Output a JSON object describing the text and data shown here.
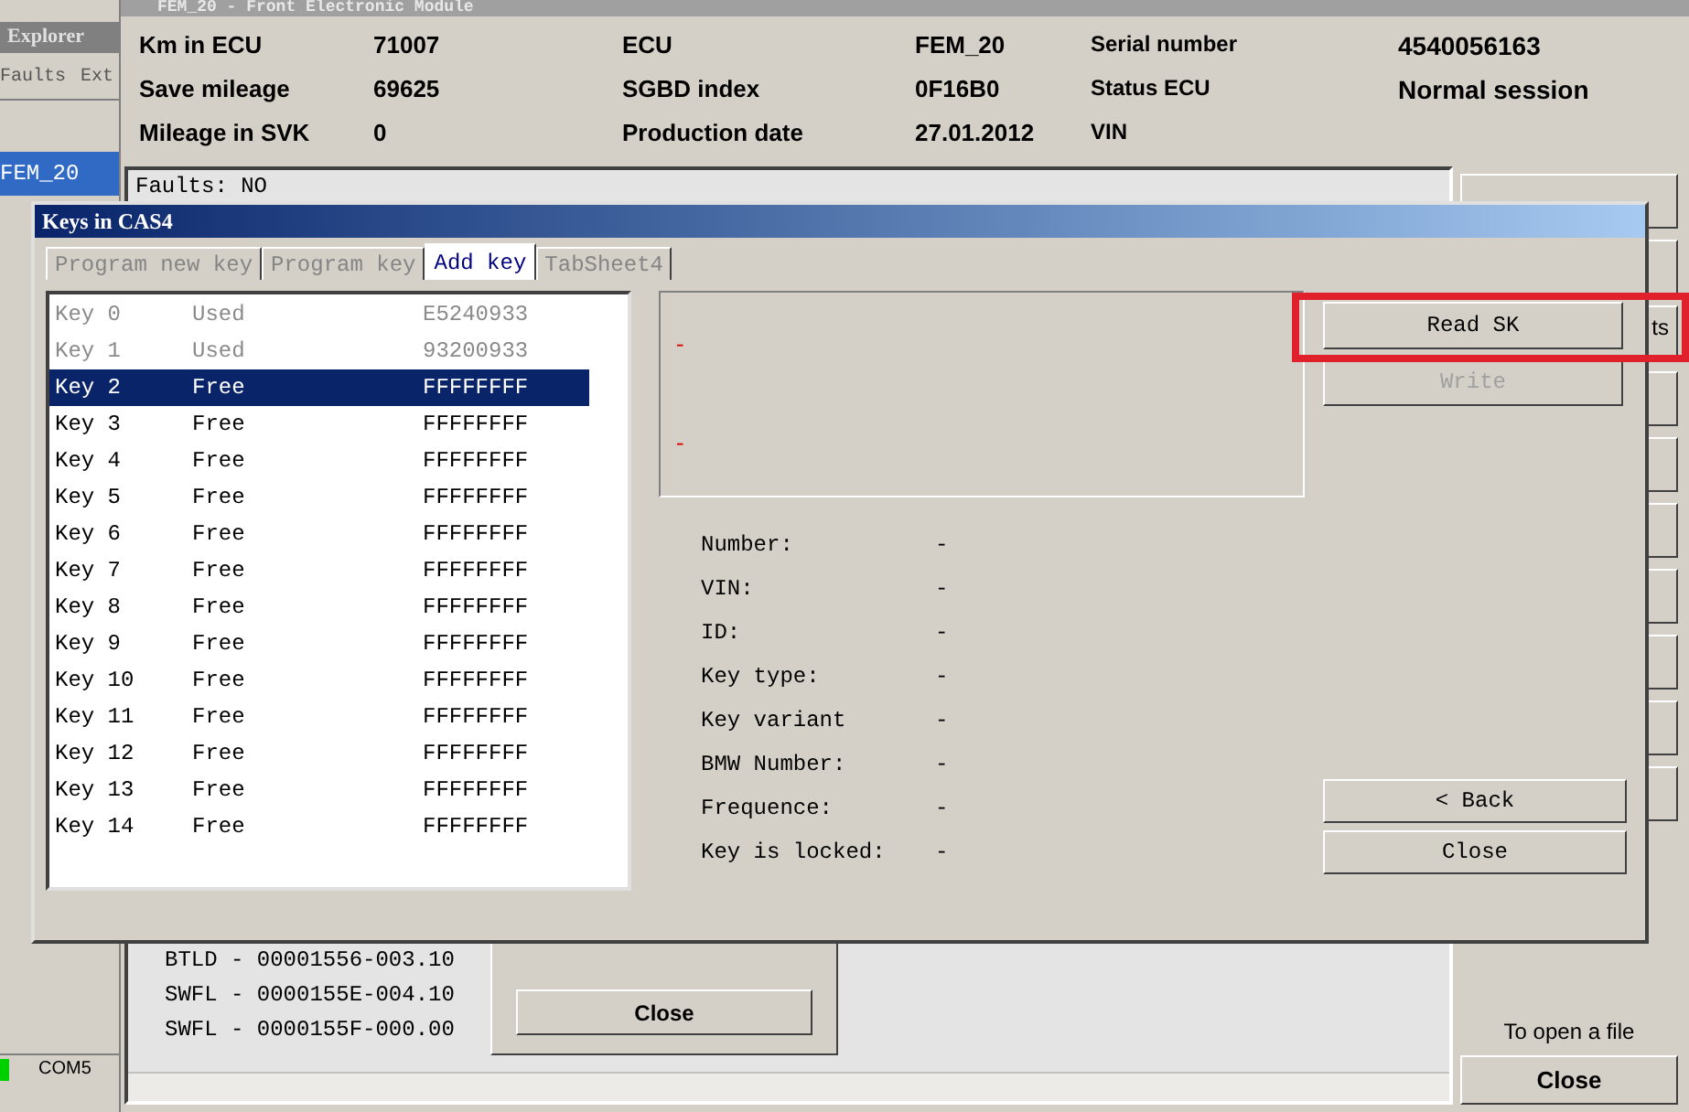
{
  "explorer": {
    "title": "Explorer",
    "menu": [
      "Faults",
      "Ext"
    ],
    "items": [
      {
        "label": "FEM_20",
        "selected": true
      }
    ],
    "status": "COM5"
  },
  "window": {
    "title": "FEM_20 - Front Electronic Module"
  },
  "info": [
    {
      "label": "Km in ECU",
      "value": "71007"
    },
    {
      "label": "Save mileage",
      "value": "69625"
    },
    {
      "label": "Mileage in SVK",
      "value": "0"
    },
    {
      "label": "ECU",
      "value": "FEM_20"
    },
    {
      "label": "SGBD index",
      "value": "0F16B0"
    },
    {
      "label": "Production date",
      "value": "27.01.2012"
    },
    {
      "label": "Serial number",
      "value": "4540056163"
    },
    {
      "label": "Status ECU",
      "value": "Normal session"
    },
    {
      "label": "VIN"
    }
  ],
  "log": {
    "header": "Faults: NO",
    "lines": [
      "BTLD - 00001556-003.10",
      "SWFL - 0000155E-004.10",
      "SWFL - 0000155F-000.00"
    ]
  },
  "inner_panel": {
    "button": "Close"
  },
  "side_buttons": [
    {
      "label": "ts"
    }
  ],
  "open_file": {
    "label": "To open a file",
    "button": "Close"
  },
  "dialog": {
    "title": "Keys in CAS4",
    "tabs": [
      {
        "label": "Program new key",
        "selected": false,
        "disabled": true
      },
      {
        "label": "Program key",
        "selected": false,
        "disabled": true
      },
      {
        "label": "Add key",
        "selected": true,
        "disabled": false
      },
      {
        "label": "TabSheet4",
        "selected": false,
        "disabled": true
      }
    ],
    "keys": [
      {
        "name": "Key 0",
        "status": "Used",
        "code": "E5240933",
        "used": true,
        "selected": false
      },
      {
        "name": "Key 1",
        "status": "Used",
        "code": "93200933",
        "used": true,
        "selected": false
      },
      {
        "name": "Key 2",
        "status": "Free",
        "code": "FFFFFFFF",
        "used": false,
        "selected": true
      },
      {
        "name": "Key 3",
        "status": "Free",
        "code": "FFFFFFFF",
        "used": false,
        "selected": false
      },
      {
        "name": "Key 4",
        "status": "Free",
        "code": "FFFFFFFF",
        "used": false,
        "selected": false
      },
      {
        "name": "Key 5",
        "status": "Free",
        "code": "FFFFFFFF",
        "used": false,
        "selected": false
      },
      {
        "name": "Key 6",
        "status": "Free",
        "code": "FFFFFFFF",
        "used": false,
        "selected": false
      },
      {
        "name": "Key 7",
        "status": "Free",
        "code": "FFFFFFFF",
        "used": false,
        "selected": false
      },
      {
        "name": "Key 8",
        "status": "Free",
        "code": "FFFFFFFF",
        "used": false,
        "selected": false
      },
      {
        "name": "Key 9",
        "status": "Free",
        "code": "FFFFFFFF",
        "used": false,
        "selected": false
      },
      {
        "name": "Key 10",
        "status": "Free",
        "code": "FFFFFFFF",
        "used": false,
        "selected": false
      },
      {
        "name": "Key 11",
        "status": "Free",
        "code": "FFFFFFFF",
        "used": false,
        "selected": false
      },
      {
        "name": "Key 12",
        "status": "Free",
        "code": "FFFFFFFF",
        "used": false,
        "selected": false
      },
      {
        "name": "Key 13",
        "status": "Free",
        "code": "FFFFFFFF",
        "used": false,
        "selected": false
      },
      {
        "name": "Key 14",
        "status": "Free",
        "code": "FFFFFFFF",
        "used": false,
        "selected": false
      }
    ],
    "status_lines": [
      "-",
      "-"
    ],
    "top_buttons": [
      {
        "label": "Read SK",
        "disabled": false,
        "highlighted": true
      },
      {
        "label": "Write",
        "disabled": true,
        "highlighted": false
      }
    ],
    "details": [
      {
        "label": "Number:",
        "value": "-"
      },
      {
        "label": "VIN:",
        "value": "-"
      },
      {
        "label": "ID:",
        "value": "-"
      },
      {
        "label": "Key type:",
        "value": "-"
      },
      {
        "label": "Key variant",
        "value": "-"
      },
      {
        "label": "BMW Number:",
        "value": "-"
      },
      {
        "label": "Frequence:",
        "value": "-"
      },
      {
        "label": "Key is locked:",
        "value": "-"
      }
    ],
    "bottom_buttons": [
      "< Back",
      "Close"
    ]
  }
}
